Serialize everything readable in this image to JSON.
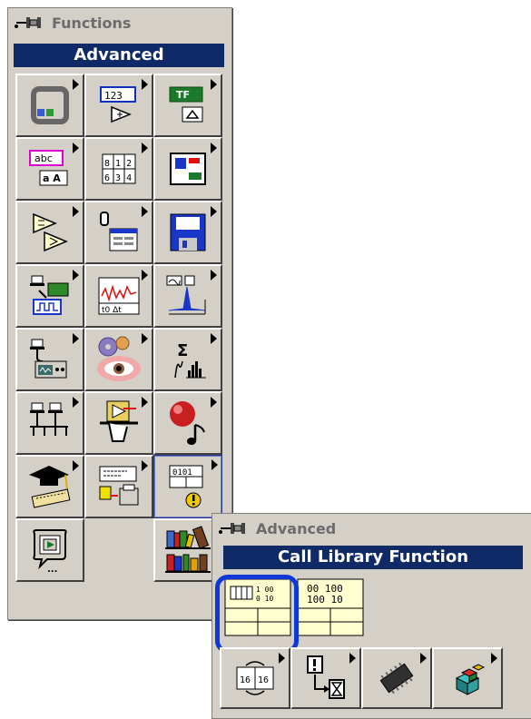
{
  "functions_palette": {
    "title": "Functions",
    "subtitle": "Advanced",
    "tiles": [
      {
        "icon": "vi-structure-icon"
      },
      {
        "icon": "numeric-icon",
        "text": "123"
      },
      {
        "icon": "boolean-icon",
        "text": "TF"
      },
      {
        "icon": "string-icon",
        "text": "abc"
      },
      {
        "icon": "array-icon",
        "text": "8 1 2 | 6 3 4"
      },
      {
        "icon": "cluster-icon"
      },
      {
        "icon": "comparison-icon"
      },
      {
        "icon": "time-dialog-icon"
      },
      {
        "icon": "file-io-icon"
      },
      {
        "icon": "data-acquisition-icon"
      },
      {
        "icon": "waveform-icon",
        "text": "t0 Δt"
      },
      {
        "icon": "analyze-icon"
      },
      {
        "icon": "instrument-io-icon"
      },
      {
        "icon": "motion-vision-icon"
      },
      {
        "icon": "mathematics-icon",
        "text": "Σ"
      },
      {
        "icon": "communication-icon"
      },
      {
        "icon": "application-control-icon"
      },
      {
        "icon": "graphics-sound-icon"
      },
      {
        "icon": "tutorial-icon"
      },
      {
        "icon": "report-generation-icon"
      },
      {
        "icon": "advanced-icon"
      },
      {
        "icon": "express-icon"
      },
      {
        "icon": "empty"
      },
      {
        "icon": "user-libraries-icon"
      }
    ]
  },
  "advanced_palette": {
    "title": "Advanced",
    "subtitle": "Call Library Function",
    "row1": [
      {
        "icon": "call-library-function-icon"
      },
      {
        "icon": "code-interface-node-icon",
        "text": "00 100 | 100 10"
      }
    ],
    "row2": [
      {
        "icon": "data-manipulation-icon",
        "text": "16 | 16"
      },
      {
        "icon": "synchronization-icon"
      },
      {
        "icon": "memory-icon"
      },
      {
        "icon": "activex-icon"
      }
    ]
  },
  "colors": {
    "panel": "#d4d0c8",
    "title_bar": "#102a68",
    "highlight": "#1038d8"
  }
}
